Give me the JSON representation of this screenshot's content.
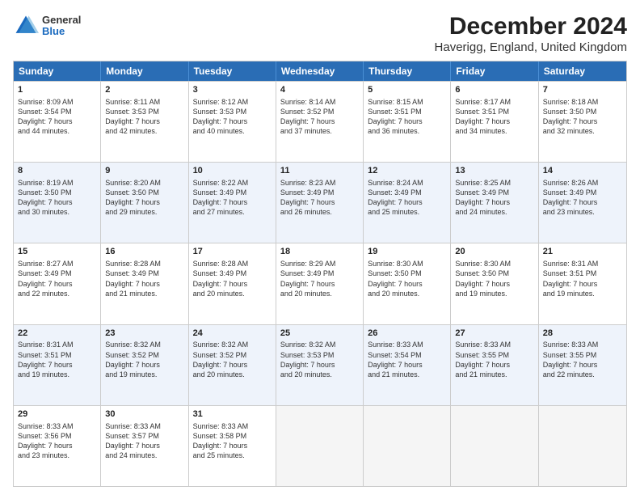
{
  "header": {
    "logo_line1": "General",
    "logo_line2": "Blue",
    "title": "December 2024",
    "subtitle": "Haverigg, England, United Kingdom"
  },
  "days_of_week": [
    "Sunday",
    "Monday",
    "Tuesday",
    "Wednesday",
    "Thursday",
    "Friday",
    "Saturday"
  ],
  "weeks": [
    [
      {
        "day": "1",
        "lines": [
          "Sunrise: 8:09 AM",
          "Sunset: 3:54 PM",
          "Daylight: 7 hours",
          "and 44 minutes."
        ]
      },
      {
        "day": "2",
        "lines": [
          "Sunrise: 8:11 AM",
          "Sunset: 3:53 PM",
          "Daylight: 7 hours",
          "and 42 minutes."
        ]
      },
      {
        "day": "3",
        "lines": [
          "Sunrise: 8:12 AM",
          "Sunset: 3:53 PM",
          "Daylight: 7 hours",
          "and 40 minutes."
        ]
      },
      {
        "day": "4",
        "lines": [
          "Sunrise: 8:14 AM",
          "Sunset: 3:52 PM",
          "Daylight: 7 hours",
          "and 37 minutes."
        ]
      },
      {
        "day": "5",
        "lines": [
          "Sunrise: 8:15 AM",
          "Sunset: 3:51 PM",
          "Daylight: 7 hours",
          "and 36 minutes."
        ]
      },
      {
        "day": "6",
        "lines": [
          "Sunrise: 8:17 AM",
          "Sunset: 3:51 PM",
          "Daylight: 7 hours",
          "and 34 minutes."
        ]
      },
      {
        "day": "7",
        "lines": [
          "Sunrise: 8:18 AM",
          "Sunset: 3:50 PM",
          "Daylight: 7 hours",
          "and 32 minutes."
        ]
      }
    ],
    [
      {
        "day": "8",
        "lines": [
          "Sunrise: 8:19 AM",
          "Sunset: 3:50 PM",
          "Daylight: 7 hours",
          "and 30 minutes."
        ]
      },
      {
        "day": "9",
        "lines": [
          "Sunrise: 8:20 AM",
          "Sunset: 3:50 PM",
          "Daylight: 7 hours",
          "and 29 minutes."
        ]
      },
      {
        "day": "10",
        "lines": [
          "Sunrise: 8:22 AM",
          "Sunset: 3:49 PM",
          "Daylight: 7 hours",
          "and 27 minutes."
        ]
      },
      {
        "day": "11",
        "lines": [
          "Sunrise: 8:23 AM",
          "Sunset: 3:49 PM",
          "Daylight: 7 hours",
          "and 26 minutes."
        ]
      },
      {
        "day": "12",
        "lines": [
          "Sunrise: 8:24 AM",
          "Sunset: 3:49 PM",
          "Daylight: 7 hours",
          "and 25 minutes."
        ]
      },
      {
        "day": "13",
        "lines": [
          "Sunrise: 8:25 AM",
          "Sunset: 3:49 PM",
          "Daylight: 7 hours",
          "and 24 minutes."
        ]
      },
      {
        "day": "14",
        "lines": [
          "Sunrise: 8:26 AM",
          "Sunset: 3:49 PM",
          "Daylight: 7 hours",
          "and 23 minutes."
        ]
      }
    ],
    [
      {
        "day": "15",
        "lines": [
          "Sunrise: 8:27 AM",
          "Sunset: 3:49 PM",
          "Daylight: 7 hours",
          "and 22 minutes."
        ]
      },
      {
        "day": "16",
        "lines": [
          "Sunrise: 8:28 AM",
          "Sunset: 3:49 PM",
          "Daylight: 7 hours",
          "and 21 minutes."
        ]
      },
      {
        "day": "17",
        "lines": [
          "Sunrise: 8:28 AM",
          "Sunset: 3:49 PM",
          "Daylight: 7 hours",
          "and 20 minutes."
        ]
      },
      {
        "day": "18",
        "lines": [
          "Sunrise: 8:29 AM",
          "Sunset: 3:49 PM",
          "Daylight: 7 hours",
          "and 20 minutes."
        ]
      },
      {
        "day": "19",
        "lines": [
          "Sunrise: 8:30 AM",
          "Sunset: 3:50 PM",
          "Daylight: 7 hours",
          "and 20 minutes."
        ]
      },
      {
        "day": "20",
        "lines": [
          "Sunrise: 8:30 AM",
          "Sunset: 3:50 PM",
          "Daylight: 7 hours",
          "and 19 minutes."
        ]
      },
      {
        "day": "21",
        "lines": [
          "Sunrise: 8:31 AM",
          "Sunset: 3:51 PM",
          "Daylight: 7 hours",
          "and 19 minutes."
        ]
      }
    ],
    [
      {
        "day": "22",
        "lines": [
          "Sunrise: 8:31 AM",
          "Sunset: 3:51 PM",
          "Daylight: 7 hours",
          "and 19 minutes."
        ]
      },
      {
        "day": "23",
        "lines": [
          "Sunrise: 8:32 AM",
          "Sunset: 3:52 PM",
          "Daylight: 7 hours",
          "and 19 minutes."
        ]
      },
      {
        "day": "24",
        "lines": [
          "Sunrise: 8:32 AM",
          "Sunset: 3:52 PM",
          "Daylight: 7 hours",
          "and 20 minutes."
        ]
      },
      {
        "day": "25",
        "lines": [
          "Sunrise: 8:32 AM",
          "Sunset: 3:53 PM",
          "Daylight: 7 hours",
          "and 20 minutes."
        ]
      },
      {
        "day": "26",
        "lines": [
          "Sunrise: 8:33 AM",
          "Sunset: 3:54 PM",
          "Daylight: 7 hours",
          "and 21 minutes."
        ]
      },
      {
        "day": "27",
        "lines": [
          "Sunrise: 8:33 AM",
          "Sunset: 3:55 PM",
          "Daylight: 7 hours",
          "and 21 minutes."
        ]
      },
      {
        "day": "28",
        "lines": [
          "Sunrise: 8:33 AM",
          "Sunset: 3:55 PM",
          "Daylight: 7 hours",
          "and 22 minutes."
        ]
      }
    ],
    [
      {
        "day": "29",
        "lines": [
          "Sunrise: 8:33 AM",
          "Sunset: 3:56 PM",
          "Daylight: 7 hours",
          "and 23 minutes."
        ]
      },
      {
        "day": "30",
        "lines": [
          "Sunrise: 8:33 AM",
          "Sunset: 3:57 PM",
          "Daylight: 7 hours",
          "and 24 minutes."
        ]
      },
      {
        "day": "31",
        "lines": [
          "Sunrise: 8:33 AM",
          "Sunset: 3:58 PM",
          "Daylight: 7 hours",
          "and 25 minutes."
        ]
      },
      {
        "day": "",
        "lines": []
      },
      {
        "day": "",
        "lines": []
      },
      {
        "day": "",
        "lines": []
      },
      {
        "day": "",
        "lines": []
      }
    ]
  ],
  "alt_rows": [
    1,
    3
  ]
}
